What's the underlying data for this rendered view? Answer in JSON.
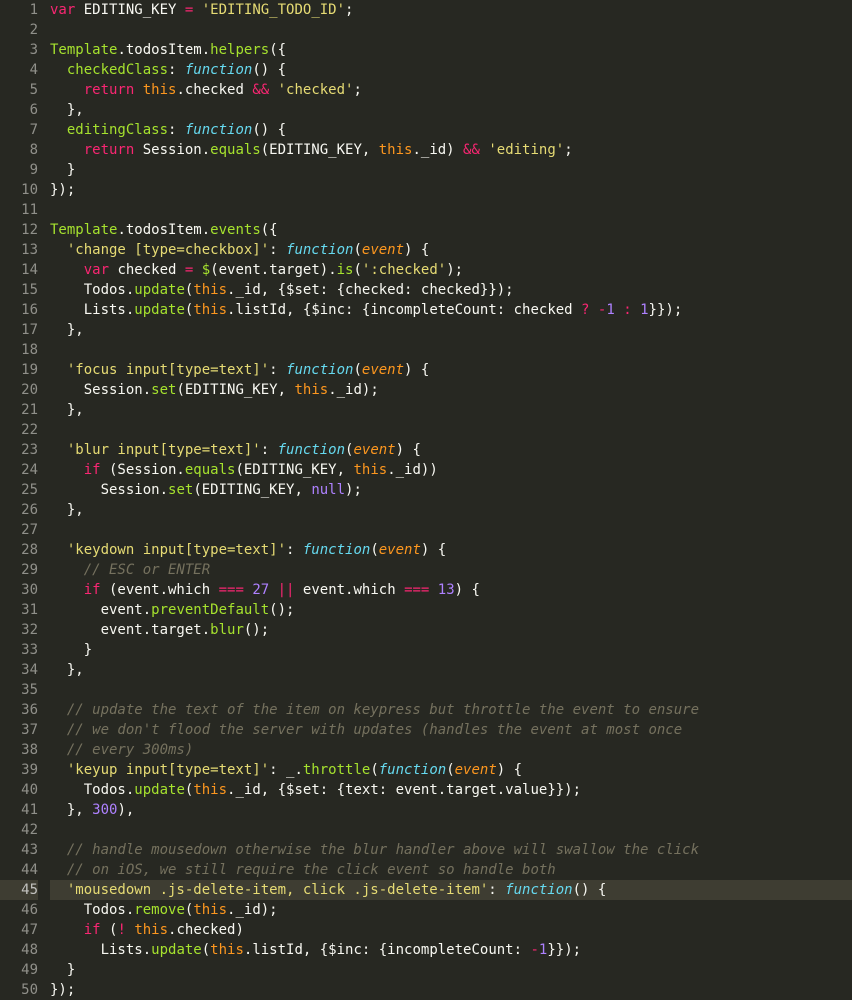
{
  "highlightedLine": 45,
  "totalLines": 50,
  "lines": [
    [
      {
        "c": "kw",
        "t": "var"
      },
      {
        "c": "id",
        "t": " EDITING_KEY "
      },
      {
        "c": "op",
        "t": "="
      },
      {
        "c": "id",
        "t": " "
      },
      {
        "c": "st",
        "t": "'EDITING_TODO_ID'"
      },
      {
        "c": "id",
        "t": ";"
      }
    ],
    [],
    [
      {
        "c": "fn",
        "t": "Template"
      },
      {
        "c": "id",
        "t": "."
      },
      {
        "c": "prop",
        "t": "todosItem"
      },
      {
        "c": "id",
        "t": "."
      },
      {
        "c": "fn",
        "t": "helpers"
      },
      {
        "c": "id",
        "t": "({"
      }
    ],
    [
      {
        "c": "id",
        "t": "  "
      },
      {
        "c": "fn",
        "t": "checkedClass"
      },
      {
        "c": "id",
        "t": ": "
      },
      {
        "c": "def",
        "t": "function"
      },
      {
        "c": "id",
        "t": "() {"
      }
    ],
    [
      {
        "c": "id",
        "t": "    "
      },
      {
        "c": "kw",
        "t": "return"
      },
      {
        "c": "id",
        "t": " "
      },
      {
        "c": "self",
        "t": "this"
      },
      {
        "c": "id",
        "t": ".checked "
      },
      {
        "c": "op",
        "t": "&&"
      },
      {
        "c": "id",
        "t": " "
      },
      {
        "c": "st",
        "t": "'checked'"
      },
      {
        "c": "id",
        "t": ";"
      }
    ],
    [
      {
        "c": "id",
        "t": "  },"
      }
    ],
    [
      {
        "c": "id",
        "t": "  "
      },
      {
        "c": "fn",
        "t": "editingClass"
      },
      {
        "c": "id",
        "t": ": "
      },
      {
        "c": "def",
        "t": "function"
      },
      {
        "c": "id",
        "t": "() {"
      }
    ],
    [
      {
        "c": "id",
        "t": "    "
      },
      {
        "c": "kw",
        "t": "return"
      },
      {
        "c": "id",
        "t": " Session."
      },
      {
        "c": "fn",
        "t": "equals"
      },
      {
        "c": "id",
        "t": "(EDITING_KEY, "
      },
      {
        "c": "self",
        "t": "this"
      },
      {
        "c": "id",
        "t": "._id) "
      },
      {
        "c": "op",
        "t": "&&"
      },
      {
        "c": "id",
        "t": " "
      },
      {
        "c": "st",
        "t": "'editing'"
      },
      {
        "c": "id",
        "t": ";"
      }
    ],
    [
      {
        "c": "id",
        "t": "  }"
      }
    ],
    [
      {
        "c": "id",
        "t": "});"
      }
    ],
    [],
    [
      {
        "c": "fn",
        "t": "Template"
      },
      {
        "c": "id",
        "t": "."
      },
      {
        "c": "prop",
        "t": "todosItem"
      },
      {
        "c": "id",
        "t": "."
      },
      {
        "c": "fn",
        "t": "events"
      },
      {
        "c": "id",
        "t": "({"
      }
    ],
    [
      {
        "c": "id",
        "t": "  "
      },
      {
        "c": "st",
        "t": "'change [type=checkbox]'"
      },
      {
        "c": "id",
        "t": ": "
      },
      {
        "c": "def",
        "t": "function"
      },
      {
        "c": "id",
        "t": "("
      },
      {
        "c": "param",
        "t": "event"
      },
      {
        "c": "id",
        "t": ") {"
      }
    ],
    [
      {
        "c": "id",
        "t": "    "
      },
      {
        "c": "kw",
        "t": "var"
      },
      {
        "c": "id",
        "t": " checked "
      },
      {
        "c": "op",
        "t": "="
      },
      {
        "c": "id",
        "t": " "
      },
      {
        "c": "fn",
        "t": "$"
      },
      {
        "c": "id",
        "t": "(event.target)."
      },
      {
        "c": "fn",
        "t": "is"
      },
      {
        "c": "id",
        "t": "("
      },
      {
        "c": "st",
        "t": "':checked'"
      },
      {
        "c": "id",
        "t": ");"
      }
    ],
    [
      {
        "c": "id",
        "t": "    Todos."
      },
      {
        "c": "fn",
        "t": "update"
      },
      {
        "c": "id",
        "t": "("
      },
      {
        "c": "self",
        "t": "this"
      },
      {
        "c": "id",
        "t": "._id, {$set: {checked: checked}});"
      }
    ],
    [
      {
        "c": "id",
        "t": "    Lists."
      },
      {
        "c": "fn",
        "t": "update"
      },
      {
        "c": "id",
        "t": "("
      },
      {
        "c": "self",
        "t": "this"
      },
      {
        "c": "id",
        "t": ".listId, {$inc: {incompleteCount: checked "
      },
      {
        "c": "op",
        "t": "?"
      },
      {
        "c": "id",
        "t": " "
      },
      {
        "c": "op",
        "t": "-"
      },
      {
        "c": "nm",
        "t": "1"
      },
      {
        "c": "id",
        "t": " "
      },
      {
        "c": "op",
        "t": ":"
      },
      {
        "c": "id",
        "t": " "
      },
      {
        "c": "nm",
        "t": "1"
      },
      {
        "c": "id",
        "t": "}});"
      }
    ],
    [
      {
        "c": "id",
        "t": "  },"
      }
    ],
    [],
    [
      {
        "c": "id",
        "t": "  "
      },
      {
        "c": "st",
        "t": "'focus input[type=text]'"
      },
      {
        "c": "id",
        "t": ": "
      },
      {
        "c": "def",
        "t": "function"
      },
      {
        "c": "id",
        "t": "("
      },
      {
        "c": "param",
        "t": "event"
      },
      {
        "c": "id",
        "t": ") {"
      }
    ],
    [
      {
        "c": "id",
        "t": "    Session."
      },
      {
        "c": "fn",
        "t": "set"
      },
      {
        "c": "id",
        "t": "(EDITING_KEY, "
      },
      {
        "c": "self",
        "t": "this"
      },
      {
        "c": "id",
        "t": "._id);"
      }
    ],
    [
      {
        "c": "id",
        "t": "  },"
      }
    ],
    [],
    [
      {
        "c": "id",
        "t": "  "
      },
      {
        "c": "st",
        "t": "'blur input[type=text]'"
      },
      {
        "c": "id",
        "t": ": "
      },
      {
        "c": "def",
        "t": "function"
      },
      {
        "c": "id",
        "t": "("
      },
      {
        "c": "param",
        "t": "event"
      },
      {
        "c": "id",
        "t": ") {"
      }
    ],
    [
      {
        "c": "id",
        "t": "    "
      },
      {
        "c": "kw",
        "t": "if"
      },
      {
        "c": "id",
        "t": " (Session."
      },
      {
        "c": "fn",
        "t": "equals"
      },
      {
        "c": "id",
        "t": "(EDITING_KEY, "
      },
      {
        "c": "self",
        "t": "this"
      },
      {
        "c": "id",
        "t": "._id))"
      }
    ],
    [
      {
        "c": "id",
        "t": "      Session."
      },
      {
        "c": "fn",
        "t": "set"
      },
      {
        "c": "id",
        "t": "(EDITING_KEY, "
      },
      {
        "c": "con",
        "t": "null"
      },
      {
        "c": "id",
        "t": ");"
      }
    ],
    [
      {
        "c": "id",
        "t": "  },"
      }
    ],
    [],
    [
      {
        "c": "id",
        "t": "  "
      },
      {
        "c": "st",
        "t": "'keydown input[type=text]'"
      },
      {
        "c": "id",
        "t": ": "
      },
      {
        "c": "def",
        "t": "function"
      },
      {
        "c": "id",
        "t": "("
      },
      {
        "c": "param",
        "t": "event"
      },
      {
        "c": "id",
        "t": ") {"
      }
    ],
    [
      {
        "c": "id",
        "t": "    "
      },
      {
        "c": "cm",
        "t": "// ESC or ENTER"
      }
    ],
    [
      {
        "c": "id",
        "t": "    "
      },
      {
        "c": "kw",
        "t": "if"
      },
      {
        "c": "id",
        "t": " (event.which "
      },
      {
        "c": "op",
        "t": "==="
      },
      {
        "c": "id",
        "t": " "
      },
      {
        "c": "nm",
        "t": "27"
      },
      {
        "c": "id",
        "t": " "
      },
      {
        "c": "op",
        "t": "||"
      },
      {
        "c": "id",
        "t": " event.which "
      },
      {
        "c": "op",
        "t": "==="
      },
      {
        "c": "id",
        "t": " "
      },
      {
        "c": "nm",
        "t": "13"
      },
      {
        "c": "id",
        "t": ") {"
      }
    ],
    [
      {
        "c": "id",
        "t": "      event."
      },
      {
        "c": "fn",
        "t": "preventDefault"
      },
      {
        "c": "id",
        "t": "();"
      }
    ],
    [
      {
        "c": "id",
        "t": "      event.target."
      },
      {
        "c": "fn",
        "t": "blur"
      },
      {
        "c": "id",
        "t": "();"
      }
    ],
    [
      {
        "c": "id",
        "t": "    }"
      }
    ],
    [
      {
        "c": "id",
        "t": "  },"
      }
    ],
    [],
    [
      {
        "c": "id",
        "t": "  "
      },
      {
        "c": "cm",
        "t": "// update the text of the item on keypress but throttle the event to ensure"
      }
    ],
    [
      {
        "c": "id",
        "t": "  "
      },
      {
        "c": "cm",
        "t": "// we don't flood the server with updates (handles the event at most once"
      }
    ],
    [
      {
        "c": "id",
        "t": "  "
      },
      {
        "c": "cm",
        "t": "// every 300ms)"
      }
    ],
    [
      {
        "c": "id",
        "t": "  "
      },
      {
        "c": "st",
        "t": "'keyup input[type=text]'"
      },
      {
        "c": "id",
        "t": ": _."
      },
      {
        "c": "fn",
        "t": "throttle"
      },
      {
        "c": "id",
        "t": "("
      },
      {
        "c": "def",
        "t": "function"
      },
      {
        "c": "id",
        "t": "("
      },
      {
        "c": "param",
        "t": "event"
      },
      {
        "c": "id",
        "t": ") {"
      }
    ],
    [
      {
        "c": "id",
        "t": "    Todos."
      },
      {
        "c": "fn",
        "t": "update"
      },
      {
        "c": "id",
        "t": "("
      },
      {
        "c": "self",
        "t": "this"
      },
      {
        "c": "id",
        "t": "._id, {$set: {text: event.target.value}});"
      }
    ],
    [
      {
        "c": "id",
        "t": "  }, "
      },
      {
        "c": "nm",
        "t": "300"
      },
      {
        "c": "id",
        "t": "),"
      }
    ],
    [],
    [
      {
        "c": "id",
        "t": "  "
      },
      {
        "c": "cm",
        "t": "// handle mousedown otherwise the blur handler above will swallow the click"
      }
    ],
    [
      {
        "c": "id",
        "t": "  "
      },
      {
        "c": "cm",
        "t": "// on iOS, we still require the click event so handle both"
      }
    ],
    [
      {
        "c": "id",
        "t": "  "
      },
      {
        "c": "st",
        "t": "'mousedown .js-delete-item, click .js-delete-item'"
      },
      {
        "c": "id",
        "t": ": "
      },
      {
        "c": "def",
        "t": "function"
      },
      {
        "c": "id",
        "t": "() {"
      }
    ],
    [
      {
        "c": "id",
        "t": "    Todos."
      },
      {
        "c": "fn",
        "t": "remove"
      },
      {
        "c": "id",
        "t": "("
      },
      {
        "c": "self",
        "t": "this"
      },
      {
        "c": "id",
        "t": "._id);"
      }
    ],
    [
      {
        "c": "id",
        "t": "    "
      },
      {
        "c": "kw",
        "t": "if"
      },
      {
        "c": "id",
        "t": " ("
      },
      {
        "c": "op",
        "t": "!"
      },
      {
        "c": "id",
        "t": " "
      },
      {
        "c": "self",
        "t": "this"
      },
      {
        "c": "id",
        "t": ".checked)"
      }
    ],
    [
      {
        "c": "id",
        "t": "      Lists."
      },
      {
        "c": "fn",
        "t": "update"
      },
      {
        "c": "id",
        "t": "("
      },
      {
        "c": "self",
        "t": "this"
      },
      {
        "c": "id",
        "t": ".listId, {$inc: {incompleteCount: "
      },
      {
        "c": "op",
        "t": "-"
      },
      {
        "c": "nm",
        "t": "1"
      },
      {
        "c": "id",
        "t": "}});"
      }
    ],
    [
      {
        "c": "id",
        "t": "  }"
      }
    ],
    [
      {
        "c": "id",
        "t": "});"
      }
    ]
  ]
}
